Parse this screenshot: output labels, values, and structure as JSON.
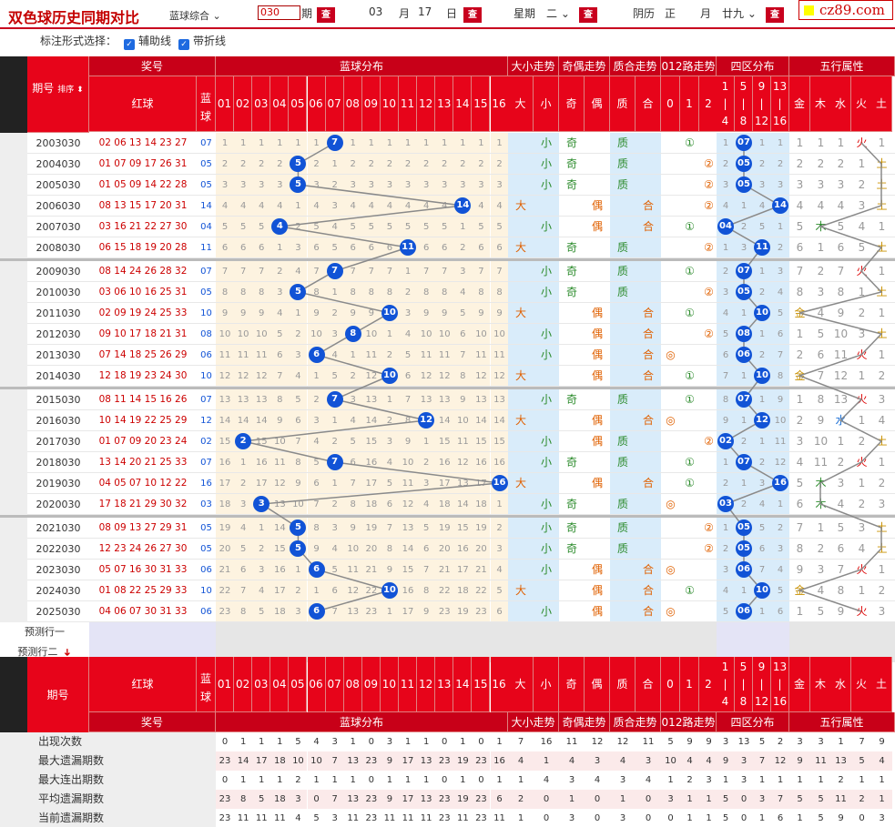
{
  "toolbar": {
    "title": "双色球历史同期对比",
    "lottery": "蓝球综合",
    "period_value": "030",
    "period_unit": "期",
    "month": "03",
    "month_unit": "月",
    "day": "17",
    "day_unit": "日",
    "week_label": "星期",
    "week": "二",
    "lunar_label": "阴历",
    "lunar_month": "正",
    "lunar_month_unit": "月",
    "lunar_day": "廿九",
    "query": "查",
    "logo": "cz89.com"
  },
  "options": {
    "label": "标注形式选择：",
    "opt1": "辅助线",
    "opt2": "带折线"
  },
  "headers": {
    "period": "期号",
    "sort": "排序",
    "red": "红球",
    "blue": "蓝球",
    "prize": "奖号",
    "blue_dist": "蓝球分布",
    "size_trend": "大小走势",
    "odd_trend": "奇偶走势",
    "prime_trend": "质合走势",
    "road_trend": "012路走势",
    "zone": "四区分布",
    "wuxing": "五行属性",
    "blue_nums": [
      "01",
      "02",
      "03",
      "04",
      "05",
      "06",
      "07",
      "08",
      "09",
      "10",
      "11",
      "12",
      "13",
      "14",
      "15",
      "16"
    ],
    "size": [
      "大",
      "小"
    ],
    "odd": [
      "奇",
      "偶"
    ],
    "prime": [
      "质",
      "合"
    ],
    "road": [
      "0",
      "1",
      "2"
    ],
    "zones": [
      [
        "1",
        "|",
        "4"
      ],
      [
        "5",
        "|",
        "8"
      ],
      [
        "9",
        "|",
        "12"
      ],
      [
        "13",
        "|",
        "16"
      ]
    ],
    "wx": [
      "金",
      "木",
      "水",
      "火",
      "土"
    ]
  },
  "rows": [
    {
      "p": "2003030",
      "red": "02 06 13 14 23 27",
      "blue": "07",
      "bi": 7,
      "sz": "小",
      "oe": "奇",
      "pc": "质",
      "rd": 1,
      "zn": 2,
      "wx": 3,
      "miss": [
        1,
        1,
        1,
        1,
        1,
        1,
        0,
        1,
        1,
        1,
        1,
        1,
        1,
        1,
        1,
        1
      ],
      "zm": [
        1,
        0,
        1,
        1
      ],
      "wm": [
        1,
        1,
        1,
        0,
        1
      ]
    },
    {
      "p": "2004030",
      "red": "01 07 09 17 26 31",
      "blue": "05",
      "bi": 5,
      "sz": "小",
      "oe": "奇",
      "pc": "质",
      "rd": 2,
      "zn": 2,
      "wx": 4,
      "miss": [
        2,
        2,
        2,
        2,
        0,
        2,
        1,
        2,
        2,
        2,
        2,
        2,
        2,
        2,
        2,
        2
      ],
      "zm": [
        2,
        0,
        2,
        2
      ],
      "wm": [
        2,
        2,
        2,
        1,
        0
      ]
    },
    {
      "p": "2005030",
      "red": "01 05 09 14 22 28",
      "blue": "05",
      "bi": 5,
      "sz": "小",
      "oe": "奇",
      "pc": "质",
      "rd": 2,
      "zn": 2,
      "wx": 4,
      "miss": [
        3,
        3,
        3,
        3,
        0,
        3,
        2,
        3,
        3,
        3,
        3,
        3,
        3,
        3,
        3,
        3
      ],
      "zm": [
        3,
        0,
        3,
        3
      ],
      "wm": [
        3,
        3,
        3,
        2,
        0
      ]
    },
    {
      "p": "2006030",
      "red": "08 13 15 17 20 31",
      "blue": "14",
      "bi": 14,
      "sz": "大",
      "oe": "偶",
      "pc": "合",
      "rd": 2,
      "zn": 4,
      "wx": 4,
      "miss": [
        4,
        4,
        4,
        4,
        1,
        4,
        3,
        4,
        4,
        4,
        4,
        4,
        4,
        0,
        4,
        4
      ],
      "zm": [
        4,
        1,
        4,
        0
      ],
      "wm": [
        4,
        4,
        4,
        3,
        0
      ]
    },
    {
      "p": "2007030",
      "red": "03 16 21 22 27 30",
      "blue": "04",
      "bi": 4,
      "sz": "小",
      "oe": "偶",
      "pc": "合",
      "rd": 1,
      "zn": 1,
      "wx": 1,
      "miss": [
        5,
        5,
        5,
        0,
        2,
        5,
        4,
        5,
        5,
        5,
        5,
        5,
        5,
        1,
        5,
        5
      ],
      "zm": [
        0,
        2,
        5,
        1
      ],
      "wm": [
        5,
        0,
        5,
        4,
        1
      ]
    },
    {
      "p": "2008030",
      "red": "06 15 18 19 20 28",
      "blue": "11",
      "bi": 11,
      "sz": "大",
      "oe": "奇",
      "pc": "质",
      "rd": 2,
      "zn": 3,
      "wx": 4,
      "miss": [
        6,
        6,
        6,
        1,
        3,
        6,
        5,
        6,
        6,
        6,
        0,
        6,
        6,
        2,
        6,
        6
      ],
      "zm": [
        1,
        3,
        0,
        2
      ],
      "wm": [
        6,
        1,
        6,
        5,
        0
      ]
    },
    {
      "p": "2009030",
      "red": "08 14 24 26 28 32",
      "blue": "07",
      "bi": 7,
      "sz": "小",
      "oe": "奇",
      "pc": "质",
      "rd": 1,
      "zn": 2,
      "wx": 3,
      "miss": [
        7,
        7,
        7,
        2,
        4,
        7,
        0,
        7,
        7,
        7,
        1,
        7,
        7,
        3,
        7,
        7
      ],
      "zm": [
        2,
        0,
        1,
        3
      ],
      "wm": [
        7,
        2,
        7,
        0,
        1
      ]
    },
    {
      "p": "2010030",
      "red": "03 06 10 16 25 31",
      "blue": "05",
      "bi": 5,
      "sz": "小",
      "oe": "奇",
      "pc": "质",
      "rd": 2,
      "zn": 2,
      "wx": 4,
      "miss": [
        8,
        8,
        8,
        3,
        0,
        8,
        1,
        8,
        8,
        8,
        2,
        8,
        8,
        4,
        8,
        8
      ],
      "zm": [
        3,
        0,
        2,
        4
      ],
      "wm": [
        8,
        3,
        8,
        1,
        0
      ]
    },
    {
      "p": "2011030",
      "red": "02 09 19 24 25 33",
      "blue": "10",
      "bi": 10,
      "sz": "大",
      "oe": "偶",
      "pc": "合",
      "rd": 1,
      "zn": 3,
      "wx": 0,
      "miss": [
        9,
        9,
        9,
        4,
        1,
        9,
        2,
        9,
        9,
        0,
        3,
        9,
        9,
        5,
        9,
        9
      ],
      "zm": [
        4,
        1,
        0,
        5
      ],
      "wm": [
        0,
        4,
        9,
        2,
        1
      ]
    },
    {
      "p": "2012030",
      "red": "09 10 17 18 21 31",
      "blue": "08",
      "bi": 8,
      "sz": "小",
      "oe": "偶",
      "pc": "合",
      "rd": 2,
      "zn": 2,
      "wx": 4,
      "miss": [
        10,
        10,
        10,
        5,
        2,
        10,
        3,
        0,
        10,
        1,
        4,
        10,
        10,
        6,
        10,
        10
      ],
      "zm": [
        5,
        0,
        1,
        6
      ],
      "wm": [
        1,
        5,
        10,
        3,
        0
      ]
    },
    {
      "p": "2013030",
      "red": "07 14 18 25 26 29",
      "blue": "06",
      "bi": 6,
      "sz": "小",
      "oe": "偶",
      "pc": "合",
      "rd": 0,
      "zn": 2,
      "wx": 3,
      "miss": [
        11,
        11,
        11,
        6,
        3,
        0,
        4,
        1,
        11,
        2,
        5,
        11,
        11,
        7,
        11,
        11
      ],
      "zm": [
        6,
        0,
        2,
        7
      ],
      "wm": [
        2,
        6,
        11,
        0,
        1
      ]
    },
    {
      "p": "2014030",
      "red": "12 18 19 23 24 30",
      "blue": "10",
      "bi": 10,
      "sz": "大",
      "oe": "偶",
      "pc": "合",
      "rd": 1,
      "zn": 3,
      "wx": 0,
      "miss": [
        12,
        12,
        12,
        7,
        4,
        1,
        5,
        2,
        12,
        0,
        6,
        12,
        12,
        8,
        12,
        12
      ],
      "zm": [
        7,
        1,
        0,
        8
      ],
      "wm": [
        0,
        7,
        12,
        1,
        2
      ]
    },
    {
      "p": "2015030",
      "red": "08 11 14 15 16 26",
      "blue": "07",
      "bi": 7,
      "sz": "小",
      "oe": "奇",
      "pc": "质",
      "rd": 1,
      "zn": 2,
      "wx": 3,
      "miss": [
        13,
        13,
        13,
        8,
        5,
        2,
        0,
        3,
        13,
        1,
        7,
        13,
        13,
        9,
        13,
        13
      ],
      "zm": [
        8,
        0,
        1,
        9
      ],
      "wm": [
        1,
        8,
        13,
        0,
        3
      ]
    },
    {
      "p": "2016030",
      "red": "10 14 19 22 25 29",
      "blue": "12",
      "bi": 12,
      "sz": "大",
      "oe": "偶",
      "pc": "合",
      "rd": 0,
      "zn": 3,
      "wx": 2,
      "miss": [
        14,
        14,
        14,
        9,
        6,
        3,
        1,
        4,
        14,
        2,
        8,
        0,
        14,
        10,
        14,
        14
      ],
      "zm": [
        9,
        1,
        0,
        10
      ],
      "wm": [
        2,
        9,
        0,
        1,
        4
      ]
    },
    {
      "p": "2017030",
      "red": "01 07 09 20 23 24",
      "blue": "02",
      "bi": 2,
      "sz": "小",
      "oe": "偶",
      "pc": "质",
      "rd": 2,
      "zn": 1,
      "wx": 4,
      "miss": [
        15,
        0,
        15,
        10,
        7,
        4,
        2,
        5,
        15,
        3,
        9,
        1,
        15,
        11,
        15,
        15
      ],
      "zm": [
        0,
        2,
        1,
        11
      ],
      "wm": [
        3,
        10,
        1,
        2,
        0
      ]
    },
    {
      "p": "2018030",
      "red": "13 14 20 21 25 33",
      "blue": "07",
      "bi": 7,
      "sz": "小",
      "oe": "奇",
      "pc": "质",
      "rd": 1,
      "zn": 2,
      "wx": 3,
      "miss": [
        16,
        1,
        16,
        11,
        8,
        5,
        0,
        6,
        16,
        4,
        10,
        2,
        16,
        12,
        16,
        16
      ],
      "zm": [
        1,
        0,
        2,
        12
      ],
      "wm": [
        4,
        11,
        2,
        0,
        1
      ]
    },
    {
      "p": "2019030",
      "red": "04 05 07 10 12 22",
      "blue": "16",
      "bi": 16,
      "sz": "大",
      "oe": "偶",
      "pc": "合",
      "rd": 1,
      "zn": 4,
      "wx": 1,
      "miss": [
        17,
        2,
        17,
        12,
        9,
        6,
        1,
        7,
        17,
        5,
        11,
        3,
        17,
        13,
        17,
        0
      ],
      "zm": [
        2,
        1,
        3,
        0
      ],
      "wm": [
        5,
        0,
        3,
        1,
        2
      ]
    },
    {
      "p": "2020030",
      "red": "17 18 21 29 30 32",
      "blue": "03",
      "bi": 3,
      "sz": "小",
      "oe": "奇",
      "pc": "质",
      "rd": 0,
      "zn": 1,
      "wx": 1,
      "miss": [
        18,
        3,
        0,
        13,
        10,
        7,
        2,
        8,
        18,
        6,
        12,
        4,
        18,
        14,
        18,
        1
      ],
      "zm": [
        0,
        2,
        4,
        1
      ],
      "wm": [
        6,
        0,
        4,
        2,
        3
      ]
    },
    {
      "p": "2021030",
      "red": "08 09 13 27 29 31",
      "blue": "05",
      "bi": 5,
      "sz": "小",
      "oe": "奇",
      "pc": "质",
      "rd": 2,
      "zn": 2,
      "wx": 4,
      "miss": [
        19,
        4,
        1,
        14,
        0,
        8,
        3,
        9,
        19,
        7,
        13,
        5,
        19,
        15,
        19,
        2
      ],
      "zm": [
        1,
        0,
        5,
        2
      ],
      "wm": [
        7,
        1,
        5,
        3,
        0
      ]
    },
    {
      "p": "2022030",
      "red": "12 23 24 26 27 30",
      "blue": "05",
      "bi": 5,
      "sz": "小",
      "oe": "奇",
      "pc": "质",
      "rd": 2,
      "zn": 2,
      "wx": 4,
      "miss": [
        20,
        5,
        2,
        15,
        0,
        9,
        4,
        10,
        20,
        8,
        14,
        6,
        20,
        16,
        20,
        3
      ],
      "zm": [
        2,
        0,
        6,
        3
      ],
      "wm": [
        8,
        2,
        6,
        4,
        0
      ]
    },
    {
      "p": "2023030",
      "red": "05 07 16 30 31 33",
      "blue": "06",
      "bi": 6,
      "sz": "小",
      "oe": "偶",
      "pc": "合",
      "rd": 0,
      "zn": 2,
      "wx": 3,
      "miss": [
        21,
        6,
        3,
        16,
        1,
        0,
        5,
        11,
        21,
        9,
        15,
        7,
        21,
        17,
        21,
        4
      ],
      "zm": [
        3,
        0,
        7,
        4
      ],
      "wm": [
        9,
        3,
        7,
        0,
        1
      ]
    },
    {
      "p": "2024030",
      "red": "01 08 22 25 29 33",
      "blue": "10",
      "bi": 10,
      "sz": "大",
      "oe": "偶",
      "pc": "合",
      "rd": 1,
      "zn": 3,
      "wx": 0,
      "miss": [
        22,
        7,
        4,
        17,
        2,
        1,
        6,
        12,
        22,
        0,
        16,
        8,
        22,
        18,
        22,
        5
      ],
      "zm": [
        4,
        1,
        0,
        5
      ],
      "wm": [
        0,
        4,
        8,
        1,
        2
      ]
    },
    {
      "p": "2025030",
      "red": "04 06 07 30 31 33",
      "blue": "06",
      "bi": 6,
      "sz": "小",
      "oe": "偶",
      "pc": "合",
      "rd": 0,
      "zn": 2,
      "wx": 3,
      "miss": [
        23,
        8,
        5,
        18,
        3,
        0,
        7,
        13,
        23,
        1,
        17,
        9,
        23,
        19,
        23,
        6
      ],
      "zm": [
        5,
        0,
        1,
        6
      ],
      "wm": [
        1,
        5,
        9,
        0,
        3
      ]
    }
  ],
  "predict": [
    "预测行一",
    "预测行二"
  ],
  "stats": [
    {
      "label": "出现次数",
      "v": [
        0,
        1,
        1,
        1,
        5,
        4,
        3,
        1,
        0,
        3,
        1,
        1,
        0,
        1,
        0,
        1,
        7,
        16,
        11,
        12,
        12,
        11,
        5,
        9,
        9,
        3,
        13,
        5,
        2,
        3,
        3,
        1,
        7,
        9
      ]
    },
    {
      "label": "最大遗漏期数",
      "v": [
        23,
        14,
        17,
        18,
        10,
        10,
        7,
        13,
        23,
        9,
        17,
        13,
        23,
        19,
        23,
        16,
        4,
        1,
        4,
        3,
        4,
        3,
        10,
        4,
        4,
        9,
        3,
        7,
        12,
        9,
        11,
        13,
        5,
        4
      ]
    },
    {
      "label": "最大连出期数",
      "v": [
        0,
        1,
        1,
        1,
        2,
        1,
        1,
        1,
        0,
        1,
        1,
        1,
        0,
        1,
        0,
        1,
        1,
        4,
        3,
        4,
        3,
        4,
        1,
        2,
        3,
        1,
        3,
        1,
        1,
        1,
        1,
        2,
        1,
        1
      ]
    },
    {
      "label": "平均遗漏期数",
      "v": [
        23,
        8,
        5,
        18,
        3,
        0,
        7,
        13,
        23,
        9,
        17,
        13,
        23,
        19,
        23,
        6,
        2,
        0,
        1,
        0,
        1,
        0,
        3,
        1,
        1,
        5,
        0,
        3,
        7,
        5,
        5,
        11,
        2,
        1
      ]
    },
    {
      "label": "当前遗漏期数",
      "v": [
        23,
        11,
        11,
        11,
        4,
        5,
        3,
        11,
        23,
        11,
        11,
        11,
        23,
        11,
        23,
        11,
        1,
        0,
        3,
        0,
        3,
        0,
        0,
        1,
        1,
        5,
        0,
        1,
        6,
        1,
        5,
        9,
        0,
        3
      ]
    }
  ]
}
